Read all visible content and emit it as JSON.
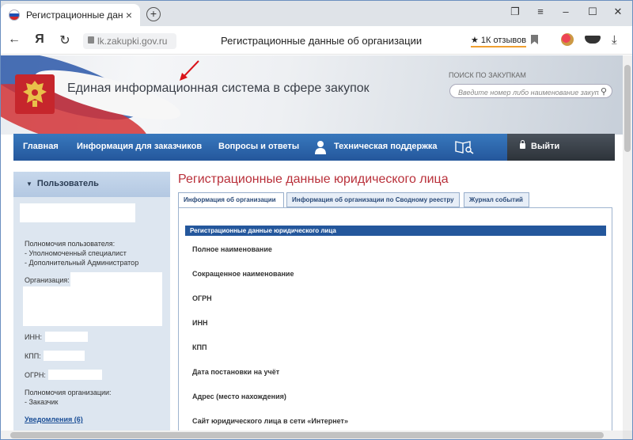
{
  "browser": {
    "tab_title": "Регистрационные данные",
    "tab_close": "×",
    "new_tab": "+",
    "url": "lk.zakupki.gov.ru",
    "page_title": "Регистрационные данные об организации",
    "reviews": "★ 1К отзывов"
  },
  "header": {
    "site_title": "Единая информационная система в сфере закупок",
    "search_caption": "ПОИСК ПО ЗАКУПКАМ",
    "search_placeholder": "Введите номер либо наименование закупки"
  },
  "nav": {
    "items": [
      "Главная",
      "Информация для заказчиков",
      "Вопросы и ответы",
      "Техническая поддержка"
    ],
    "logout": "Выйти"
  },
  "sidebar": {
    "title": "Пользователь",
    "powers_label": "Полномочия пользователя:",
    "powers": [
      "- Уполномоченный специалист",
      "- Дополнительный Администратор"
    ],
    "org_label": "Организация:",
    "inn_label": "ИНН:",
    "kpp_label": "КПП:",
    "ogrn_label": "ОГРН:",
    "org_powers_label": "Полномочия организации:",
    "org_powers": "- Заказчик",
    "notifications": "Уведомления (6)"
  },
  "main": {
    "title": "Регистрационные данные юридического лица",
    "tabs": [
      "Информация об организации",
      "Информация об организации по Сводному реестру",
      "Журнал событий"
    ],
    "section_title": "Регистрационные данные юридического лица",
    "fields": [
      "Полное наименование",
      "Сокращенное наименование",
      "ОГРН",
      "ИНН",
      "КПП",
      "Дата постановки на учёт",
      "Адрес (место нахождения)",
      "Сайт юридического лица в сети «Интернет»"
    ]
  }
}
